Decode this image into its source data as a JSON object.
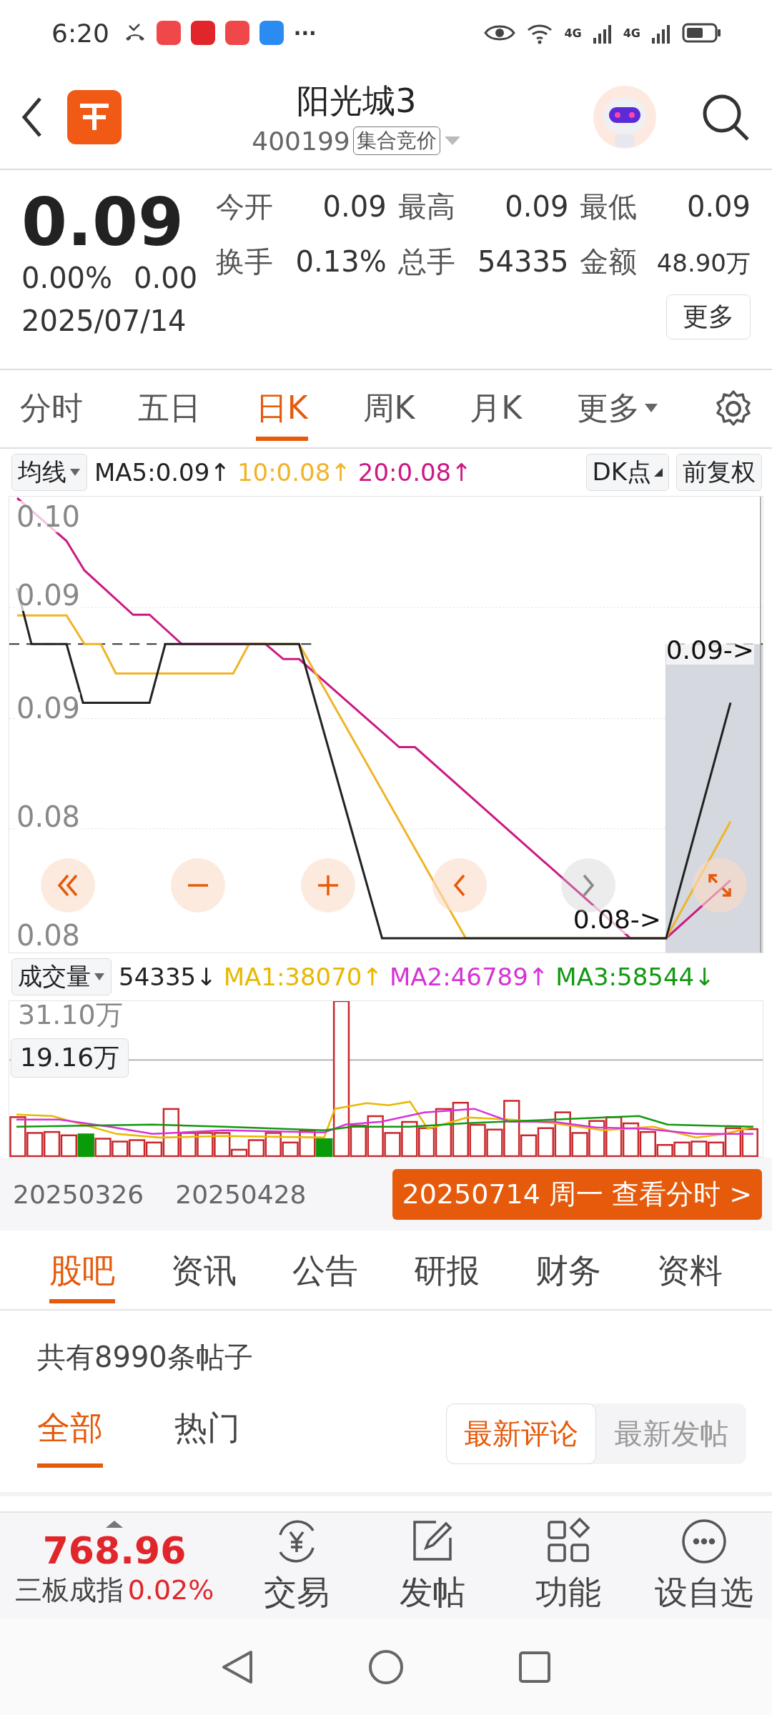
{
  "status_bar": {
    "time": "6:20",
    "more": "···",
    "network": [
      "4G",
      "4G"
    ]
  },
  "header": {
    "title": "阳光城3",
    "code": "400199",
    "badge": "集合竞价"
  },
  "quote": {
    "price": "0.09",
    "change_pct": "0.00%",
    "change": "0.00",
    "date": "2025/07/14",
    "more_button": "更多",
    "stats": [
      {
        "label": "今开",
        "value": "0.09"
      },
      {
        "label": "最高",
        "value": "0.09"
      },
      {
        "label": "最低",
        "value": "0.09"
      },
      {
        "label": "换手",
        "value": "0.13%"
      },
      {
        "label": "总手",
        "value": "54335"
      },
      {
        "label": "金额",
        "value": "48.90万"
      }
    ]
  },
  "period_tabs": [
    {
      "label": "分时",
      "selected": false
    },
    {
      "label": "五日",
      "selected": false
    },
    {
      "label": "日K",
      "selected": true
    },
    {
      "label": "周K",
      "selected": false
    },
    {
      "label": "月K",
      "selected": false
    },
    {
      "label": "更多",
      "selected": false
    }
  ],
  "ma_bar": {
    "selector": "均线",
    "items": [
      {
        "text": "MA5:0.09↑",
        "color": "#222222"
      },
      {
        "text": "10:0.08↑",
        "color": "#f0b429"
      },
      {
        "text": "20:0.08↑",
        "color": "#cc1a84"
      }
    ],
    "dk_button": "DK点",
    "adjust_button": "前复权"
  },
  "price_chart": {
    "y_labels": [
      "0.10",
      "0.09",
      "0.09",
      "0.08",
      "0.08"
    ],
    "high_marker": "0.09->",
    "low_marker": "0.08->"
  },
  "volume_bar": {
    "selector": "成交量",
    "value": "54335↓",
    "items": [
      {
        "text": "MA1:38070↑",
        "color": "#e8b800"
      },
      {
        "text": "MA2:46789↑",
        "color": "#d633d6"
      },
      {
        "text": "MA3:58544↓",
        "color": "#119911"
      }
    ]
  },
  "volume_chart": {
    "top_label": "31.10万",
    "cursor_label": "19.16万"
  },
  "dates": [
    "20250326",
    "20250428"
  ],
  "day_banner": "20250714 周一 查看分时 >",
  "info_tabs": [
    {
      "label": "股吧",
      "selected": true
    },
    {
      "label": "资讯",
      "selected": false
    },
    {
      "label": "公告",
      "selected": false
    },
    {
      "label": "研报",
      "selected": false
    },
    {
      "label": "财务",
      "selected": false
    },
    {
      "label": "资料",
      "selected": false
    }
  ],
  "post_count": "共有8990条帖子",
  "post_tabs": [
    {
      "label": "全部",
      "selected": true
    },
    {
      "label": "热门",
      "selected": false
    }
  ],
  "sort_toggle": [
    {
      "label": "最新评论",
      "selected": true
    },
    {
      "label": "最新发帖",
      "selected": false
    }
  ],
  "bottom_bar": {
    "index_value": "768.96",
    "index_name": "三板成指",
    "index_pct": "0.02%",
    "items": [
      {
        "label": "交易"
      },
      {
        "label": "发帖"
      },
      {
        "label": "功能"
      },
      {
        "label": "设自选"
      }
    ]
  }
}
